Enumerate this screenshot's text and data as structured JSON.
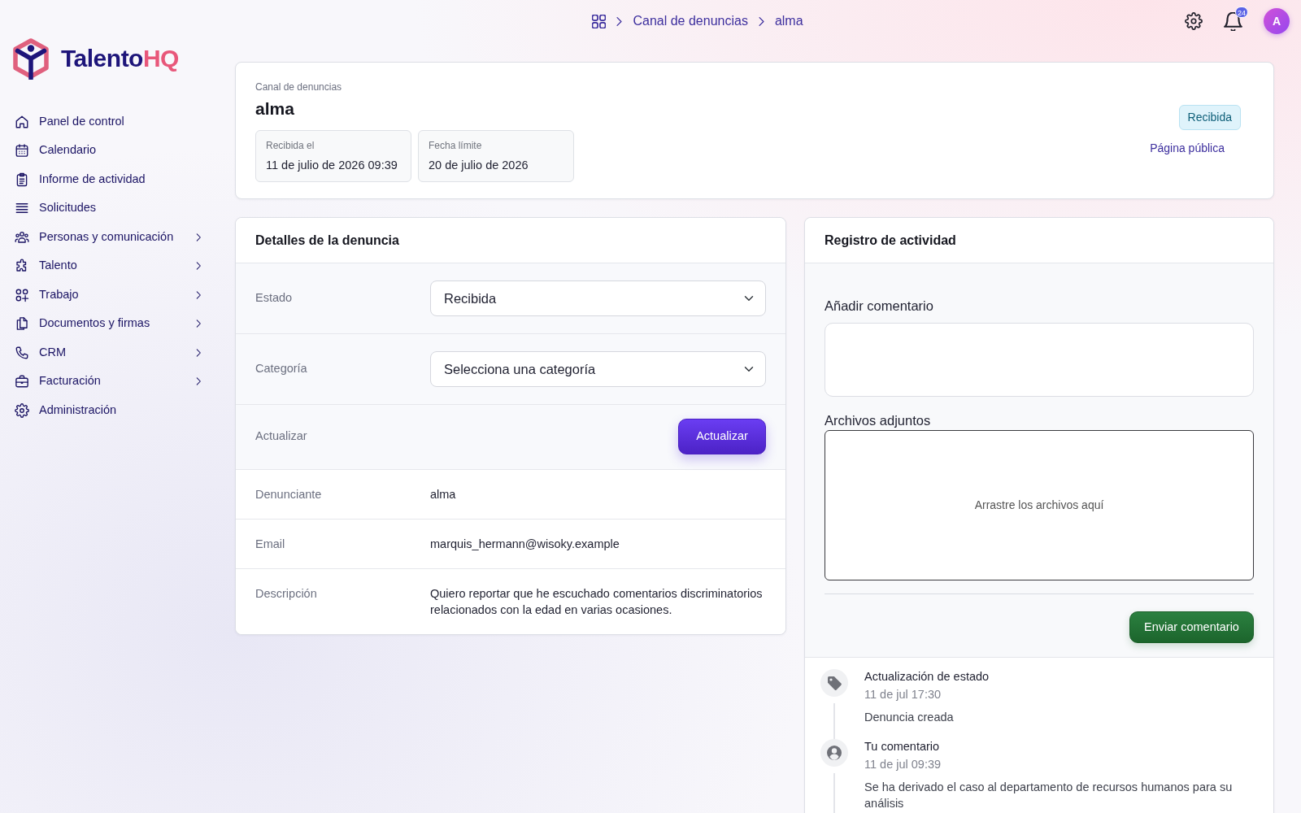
{
  "breadcrumb": [
    "Canal de denuncias",
    "alma"
  ],
  "topbar": {
    "notification_count": "24",
    "avatar_initial": "A"
  },
  "logo": {
    "text": "Talento",
    "accent": "HQ"
  },
  "sidebar": {
    "items": [
      {
        "label": "Panel de control",
        "submenu": false
      },
      {
        "label": "Calendario",
        "submenu": false
      },
      {
        "label": "Informe de actividad",
        "submenu": false
      },
      {
        "label": "Solicitudes",
        "submenu": false
      },
      {
        "label": "Personas y comunicación",
        "submenu": true
      },
      {
        "label": "Talento",
        "submenu": true
      },
      {
        "label": "Trabajo",
        "submenu": true
      },
      {
        "label": "Documentos y firmas",
        "submenu": true
      },
      {
        "label": "CRM",
        "submenu": true
      },
      {
        "label": "Facturación",
        "submenu": true
      },
      {
        "label": "Administración",
        "submenu": false
      }
    ]
  },
  "header": {
    "section": "Canal de denuncias",
    "title": "alma",
    "dates": [
      {
        "label": "Recibida el",
        "value": "11 de julio de 2026 09:39"
      },
      {
        "label": "Fecha límite",
        "value": "20 de julio de 2026"
      }
    ],
    "status": "Recibida",
    "public_link": "Página pública"
  },
  "details": {
    "title": "Detalles de la denuncia",
    "rows": [
      {
        "kind": "select",
        "label": "Estado",
        "value": "Recibida"
      },
      {
        "kind": "select",
        "label": "Categoría",
        "value": "Selecciona una categoría"
      },
      {
        "kind": "action",
        "label": "Actualizar",
        "button": "Actualizar"
      },
      {
        "kind": "text",
        "label": "Denunciante",
        "value": "alma"
      },
      {
        "kind": "text",
        "label": "Email",
        "value": "marquis_hermann@wisoky.example"
      },
      {
        "kind": "text",
        "label": "Descripción",
        "value": "Quiero reportar que he escuchado comentarios discriminatorios relacionados con la edad en varias ocasiones."
      }
    ]
  },
  "activity": {
    "title": "Registro de actividad",
    "comment_label": "Añadir comentario",
    "attachments_label": "Archivos adjuntos",
    "dropzone_text": "Arrastre los archivos aquí",
    "submit": "Enviar comentario",
    "entries": [
      {
        "kind": "status",
        "title": "Actualización de estado",
        "time": "11 de jul 17:30",
        "text": "Denuncia creada"
      },
      {
        "kind": "comment",
        "title": "Tu comentario",
        "time": "11 de jul 09:39",
        "text": "Se ha derivado el caso al departamento de recursos humanos para su análisis"
      }
    ]
  }
}
